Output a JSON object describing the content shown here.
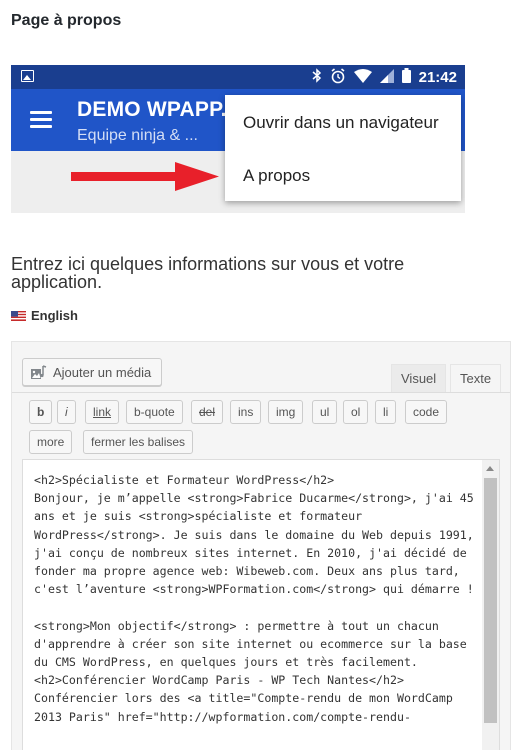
{
  "page": {
    "title": "Page à propos"
  },
  "phone": {
    "status_time": "21:42",
    "app_title": "DEMO WPAPP.I",
    "app_subtitle": "Equipe ninja & ...",
    "menu_items": [
      "Ouvrir dans un navigateur",
      "A propos"
    ],
    "arrow_color": "#e8202a",
    "appbar_color": "#2055c8",
    "statusbar_color": "#1a3e8f"
  },
  "intro": {
    "text": "Entrez ici quelques informations sur vous et votre application.",
    "language": "English"
  },
  "editor": {
    "add_media_label": "Ajouter un média",
    "tabs": {
      "visual": "Visuel",
      "text": "Texte"
    },
    "buttons": [
      "b",
      "i",
      "link",
      "b-quote",
      "del",
      "ins",
      "img",
      "ul",
      "ol",
      "li",
      "code",
      "more",
      "fermer les balises"
    ],
    "content": "<h2>Spécialiste et Formateur WordPress</h2>\nBonjour, je m’appelle <strong>Fabrice Ducarme</strong>, j'ai 45 ans et je suis <strong>spécialiste et formateur WordPress</strong>. Je suis dans le domaine du Web depuis 1991, j'ai conçu de nombreux sites internet. En 2010, j'ai décidé de fonder ma propre agence web: Wibeweb.com. Deux ans plus tard, c'est l’aventure <strong>WPFormation.com</strong> qui démarre !\n\n<strong>Mon objectif</strong> : permettre à tout un chacun d'apprendre à créer son site internet ou ecommerce sur la base du CMS WordPress, en quelques jours et très facilement.\n<h2>Conférencier WordCamp Paris - WP Tech Nantes</h2>\nConférencier lors des <a title=\"Compte-rendu de mon WordCamp 2013 Paris\" href=\"http://wpformation.com/compte-rendu-"
  }
}
